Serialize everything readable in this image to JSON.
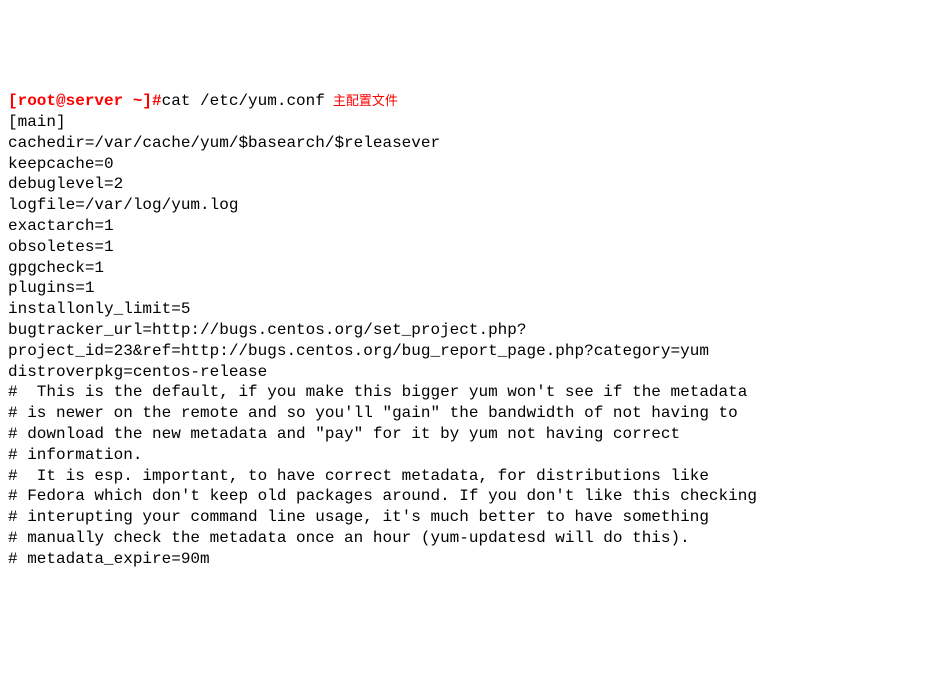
{
  "prompt": {
    "user": "[root@server ~]#",
    "command": "cat /etc/yum.conf",
    "annotation": "主配置文件"
  },
  "output": {
    "l0": "[main]",
    "l1": "cachedir=/var/cache/yum/$basearch/$releasever",
    "l2": "keepcache=0",
    "l3": "debuglevel=2",
    "l4": "logfile=/var/log/yum.log",
    "l5": "exactarch=1",
    "l6": "obsoletes=1",
    "l7": "gpgcheck=1",
    "l8": "plugins=1",
    "l9": "installonly_limit=5",
    "l10": "bugtracker_url=http://bugs.centos.org/set_project.php?project_id=23&ref=http://bugs.centos.org/bug_report_page.php?category=yum",
    "l11": "distroverpkg=centos-release",
    "l12": "",
    "l13": "",
    "l14": "#  This is the default, if you make this bigger yum won't see if the metadata",
    "l15": "# is newer on the remote and so you'll \"gain\" the bandwidth of not having to",
    "l16": "# download the new metadata and \"pay\" for it by yum not having correct",
    "l17": "# information.",
    "l18": "#  It is esp. important, to have correct metadata, for distributions like",
    "l19": "# Fedora which don't keep old packages around. If you don't like this checking",
    "l20": "# interupting your command line usage, it's much better to have something",
    "l21": "# manually check the metadata once an hour (yum-updatesd will do this).",
    "l22": "# metadata_expire=90m"
  }
}
